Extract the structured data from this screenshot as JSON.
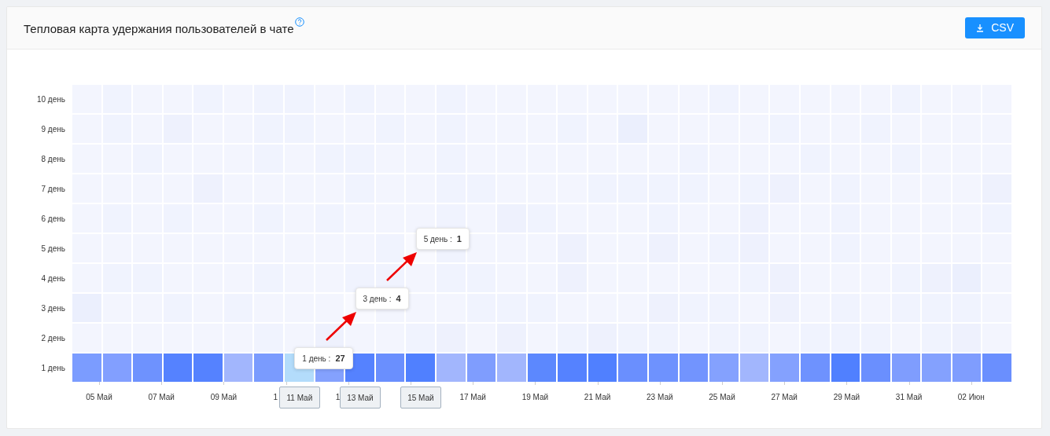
{
  "panel": {
    "title": "Тепловая карта удержания пользователей в чате",
    "export_button": {
      "label": "CSV"
    }
  },
  "heatmap": {
    "rows": [
      {
        "label": "10 день",
        "cells": [
          {
            "color": "#f3f5fe"
          },
          {
            "color": "#f0f3fe"
          },
          {
            "color": "#f3f5fe"
          },
          {
            "color": "#f3f5fe"
          },
          {
            "color": "#f0f3fe"
          },
          {
            "color": "#f3f5fe"
          },
          {
            "color": "#f0f3fe"
          },
          {
            "color": "#f0f3fe"
          },
          {
            "color": "#f3f5fe"
          },
          {
            "color": "#f0f3fe"
          },
          {
            "color": "#f3f5fe"
          },
          {
            "color": "#f3f5fe"
          },
          {
            "color": "#f0f3fe"
          },
          {
            "color": "#f3f5fe"
          },
          {
            "color": "#f3f5fe"
          },
          {
            "color": "#f3f5fe"
          },
          {
            "color": "#f3f5fe"
          },
          {
            "color": "#f3f5fe"
          },
          {
            "color": "#f3f5fe"
          },
          {
            "color": "#f3f5fe"
          },
          {
            "color": "#f3f5fe"
          },
          {
            "color": "#f0f3fe"
          },
          {
            "color": "#f3f5fe"
          },
          {
            "color": "#f3f5fe"
          },
          {
            "color": "#f3f5fe"
          },
          {
            "color": "#f3f5fe"
          },
          {
            "color": "#f3f5fe"
          },
          {
            "color": "#f0f3fe"
          },
          {
            "color": "#f3f5fe"
          },
          {
            "color": "#f3f5fe"
          },
          {
            "color": "#f3f5fe"
          }
        ]
      },
      {
        "label": "9 день",
        "cells": [
          {
            "color": "#f3f5fe"
          },
          {
            "color": "#f0f3fe"
          },
          {
            "color": "#f3f5fe"
          },
          {
            "color": "#eef1fd"
          },
          {
            "color": "#f3f5fe"
          },
          {
            "color": "#f3f5fe"
          },
          {
            "color": "#f0f3fe"
          },
          {
            "color": "#f0f3fe"
          },
          {
            "color": "#f3f5fe"
          },
          {
            "color": "#f3f5fe"
          },
          {
            "color": "#f0f3fe"
          },
          {
            "color": "#f3f5fe"
          },
          {
            "color": "#f0f3fe"
          },
          {
            "color": "#f3f5fe"
          },
          {
            "color": "#f3f5fe"
          },
          {
            "color": "#f3f5fe"
          },
          {
            "color": "#f0f3fe"
          },
          {
            "color": "#f3f5fe"
          },
          {
            "color": "#ebeffd"
          },
          {
            "color": "#f3f5fe"
          },
          {
            "color": "#f3f5fe"
          },
          {
            "color": "#f3f5fe"
          },
          {
            "color": "#f3f5fe"
          },
          {
            "color": "#f0f3fe"
          },
          {
            "color": "#f3f5fe"
          },
          {
            "color": "#f3f5fe"
          },
          {
            "color": "#f0f3fe"
          },
          {
            "color": "#f3f5fe"
          },
          {
            "color": "#f3f5fe"
          },
          {
            "color": "#f3f5fe"
          },
          {
            "color": "#f3f5fe"
          }
        ]
      },
      {
        "label": "8 день",
        "cells": [
          {
            "color": "#f3f5fe"
          },
          {
            "color": "#f3f5fe"
          },
          {
            "color": "#f0f3fe"
          },
          {
            "color": "#f3f5fe"
          },
          {
            "color": "#f3f5fe"
          },
          {
            "color": "#f3f5fe"
          },
          {
            "color": "#f0f3fe"
          },
          {
            "color": "#f3f5fe"
          },
          {
            "color": "#f0f3fe"
          },
          {
            "color": "#f0f3fe"
          },
          {
            "color": "#f3f5fe"
          },
          {
            "color": "#f3f5fe"
          },
          {
            "color": "#f0f3fe"
          },
          {
            "color": "#f3f5fe"
          },
          {
            "color": "#f3f5fe"
          },
          {
            "color": "#f3f5fe"
          },
          {
            "color": "#f3f5fe"
          },
          {
            "color": "#f3f5fe"
          },
          {
            "color": "#f3f5fe"
          },
          {
            "color": "#f3f5fe"
          },
          {
            "color": "#f0f3fe"
          },
          {
            "color": "#f3f5fe"
          },
          {
            "color": "#f3f5fe"
          },
          {
            "color": "#f3f5fe"
          },
          {
            "color": "#f0f3fe"
          },
          {
            "color": "#f3f5fe"
          },
          {
            "color": "#f3f5fe"
          },
          {
            "color": "#f0f3fe"
          },
          {
            "color": "#f3f5fe"
          },
          {
            "color": "#f3f5fe"
          },
          {
            "color": "#f3f5fe"
          }
        ]
      },
      {
        "label": "7 день",
        "cells": [
          {
            "color": "#f3f5fe"
          },
          {
            "color": "#f3f5fe"
          },
          {
            "color": "#f3f5fe"
          },
          {
            "color": "#f3f5fe"
          },
          {
            "color": "#eef1fd"
          },
          {
            "color": "#f3f5fe"
          },
          {
            "color": "#f3f5fe"
          },
          {
            "color": "#f3f5fe"
          },
          {
            "color": "#f3f5fe"
          },
          {
            "color": "#f0f3fe"
          },
          {
            "color": "#f3f5fe"
          },
          {
            "color": "#f3f5fe"
          },
          {
            "color": "#f0f3fe"
          },
          {
            "color": "#f0f3fe"
          },
          {
            "color": "#f3f5fe"
          },
          {
            "color": "#f3f5fe"
          },
          {
            "color": "#f3f5fe"
          },
          {
            "color": "#f0f3fe"
          },
          {
            "color": "#f0f3fe"
          },
          {
            "color": "#f0f3fe"
          },
          {
            "color": "#f0f3fe"
          },
          {
            "color": "#f3f5fe"
          },
          {
            "color": "#f0f3fe"
          },
          {
            "color": "#eef1fd"
          },
          {
            "color": "#f3f5fe"
          },
          {
            "color": "#f0f3fe"
          },
          {
            "color": "#f3f5fe"
          },
          {
            "color": "#f3f5fe"
          },
          {
            "color": "#f3f5fe"
          },
          {
            "color": "#f3f5fe"
          },
          {
            "color": "#eef1fd"
          }
        ]
      },
      {
        "label": "6 день",
        "cells": [
          {
            "color": "#f3f5fe"
          },
          {
            "color": "#f0f3fe"
          },
          {
            "color": "#f3f5fe"
          },
          {
            "color": "#f0f3fe"
          },
          {
            "color": "#f3f5fe"
          },
          {
            "color": "#f3f5fe"
          },
          {
            "color": "#f0f3fe"
          },
          {
            "color": "#f3f5fe"
          },
          {
            "color": "#f0f3fe"
          },
          {
            "color": "#f3f5fe"
          },
          {
            "color": "#f3f5fe"
          },
          {
            "color": "#f3f5fe"
          },
          {
            "color": "#f0f3fe"
          },
          {
            "color": "#f3f5fe"
          },
          {
            "color": "#eef1fd"
          },
          {
            "color": "#f0f3fe"
          },
          {
            "color": "#f3f5fe"
          },
          {
            "color": "#f3f5fe"
          },
          {
            "color": "#f3f5fe"
          },
          {
            "color": "#f0f3fe"
          },
          {
            "color": "#f3f5fe"
          },
          {
            "color": "#f3f5fe"
          },
          {
            "color": "#eef1fd"
          },
          {
            "color": "#f3f5fe"
          },
          {
            "color": "#f3f5fe"
          },
          {
            "color": "#f0f3fe"
          },
          {
            "color": "#f3f5fe"
          },
          {
            "color": "#f3f5fe"
          },
          {
            "color": "#f3f5fe"
          },
          {
            "color": "#f3f5fe"
          },
          {
            "color": "#f0f3fe"
          }
        ]
      },
      {
        "label": "5 день",
        "cells": [
          {
            "color": "#f3f5fe"
          },
          {
            "color": "#f3f5fe"
          },
          {
            "color": "#f3f5fe"
          },
          {
            "color": "#f3f5fe"
          },
          {
            "color": "#f3f5fe"
          },
          {
            "color": "#f3f5fe"
          },
          {
            "color": "#f3f5fe"
          },
          {
            "color": "#f3f5fe"
          },
          {
            "color": "#f3f5fe"
          },
          {
            "color": "#f3f5fe"
          },
          {
            "color": "#f0f3fe"
          },
          {
            "color": "#f8f9ff",
            "tooltip": {
              "label": "5 день :",
              "value": "1",
              "arrow_in": true
            },
            "pointer": "15 Май"
          },
          {
            "color": "#f0f3fe"
          },
          {
            "color": "#f3f5fe"
          },
          {
            "color": "#f3f5fe"
          },
          {
            "color": "#f3f5fe"
          },
          {
            "color": "#eef1fd"
          },
          {
            "color": "#f3f5fe"
          },
          {
            "color": "#f3f5fe"
          },
          {
            "color": "#eef1fd"
          },
          {
            "color": "#f3f5fe"
          },
          {
            "color": "#f0f3fe"
          },
          {
            "color": "#eef1fd"
          },
          {
            "color": "#f3f5fe"
          },
          {
            "color": "#f3f5fe"
          },
          {
            "color": "#f0f3fe"
          },
          {
            "color": "#f3f5fe"
          },
          {
            "color": "#f3f5fe"
          },
          {
            "color": "#f3f5fe"
          },
          {
            "color": "#f3f5fe"
          },
          {
            "color": "#f3f5fe"
          }
        ]
      },
      {
        "label": "4 день",
        "cells": [
          {
            "color": "#f3f5fe"
          },
          {
            "color": "#f0f3fe"
          },
          {
            "color": "#f0f3fe"
          },
          {
            "color": "#f3f5fe"
          },
          {
            "color": "#f3f5fe"
          },
          {
            "color": "#f3f5fe"
          },
          {
            "color": "#f0f3fe"
          },
          {
            "color": "#f3f5fe"
          },
          {
            "color": "#f3f5fe"
          },
          {
            "color": "#f0f3fe"
          },
          {
            "color": "#f0f3fe"
          },
          {
            "color": "#f3f5fe"
          },
          {
            "color": "#f0f3fe"
          },
          {
            "color": "#f0f3fe"
          },
          {
            "color": "#f3f5fe"
          },
          {
            "color": "#f3f5fe"
          },
          {
            "color": "#eef1fd"
          },
          {
            "color": "#f3f5fe"
          },
          {
            "color": "#f3f5fe"
          },
          {
            "color": "#f3f5fe"
          },
          {
            "color": "#f3f5fe"
          },
          {
            "color": "#f3f5fe"
          },
          {
            "color": "#f0f3fe"
          },
          {
            "color": "#eef1fd"
          },
          {
            "color": "#f3f5fe"
          },
          {
            "color": "#f3f5fe"
          },
          {
            "color": "#f3f5fe"
          },
          {
            "color": "#f0f3fe"
          },
          {
            "color": "#eef1fd"
          },
          {
            "color": "#ebeffd"
          },
          {
            "color": "#f3f5fe"
          }
        ]
      },
      {
        "label": "3 день",
        "cells": [
          {
            "color": "#ebeffd"
          },
          {
            "color": "#f3f5fe"
          },
          {
            "color": "#f3f5fe"
          },
          {
            "color": "#f0f3fe"
          },
          {
            "color": "#f3f5fe"
          },
          {
            "color": "#f0f3fe"
          },
          {
            "color": "#f3f5fe"
          },
          {
            "color": "#f3f5fe"
          },
          {
            "color": "#f3f5fe"
          },
          {
            "color": "#f8f9ff",
            "tooltip": {
              "label": "3 день :",
              "value": "4",
              "arrow_in": true
            },
            "pointer": "13 Май"
          },
          {
            "color": "#f3f5fe"
          },
          {
            "color": "#f3f5fe"
          },
          {
            "color": "#f3f5fe"
          },
          {
            "color": "#f0f3fe"
          },
          {
            "color": "#f0f3fe"
          },
          {
            "color": "#f0f3fe"
          },
          {
            "color": "#f3f5fe"
          },
          {
            "color": "#f3f5fe"
          },
          {
            "color": "#f3f5fe"
          },
          {
            "color": "#eef1fd"
          },
          {
            "color": "#f0f3fe"
          },
          {
            "color": "#f0f3fe"
          },
          {
            "color": "#f3f5fe"
          },
          {
            "color": "#eef1fd"
          },
          {
            "color": "#f3f5fe"
          },
          {
            "color": "#f0f3fe"
          },
          {
            "color": "#f3f5fe"
          },
          {
            "color": "#f0f3fe"
          },
          {
            "color": "#f0f3fe"
          },
          {
            "color": "#f0f3fe"
          },
          {
            "color": "#f3f5fe"
          }
        ]
      },
      {
        "label": "2 день",
        "cells": [
          {
            "color": "#f3f5fe"
          },
          {
            "color": "#f3f5fe"
          },
          {
            "color": "#f3f5fe"
          },
          {
            "color": "#f3f5fe"
          },
          {
            "color": "#f3f5fe"
          },
          {
            "color": "#f3f5fe"
          },
          {
            "color": "#f0f3fe"
          },
          {
            "color": "#f3f5fe"
          },
          {
            "color": "#eef1fd"
          },
          {
            "color": "#f3f5fe"
          },
          {
            "color": "#f3f5fe"
          },
          {
            "color": "#f0f3fe"
          },
          {
            "color": "#eef1fd"
          },
          {
            "color": "#f3f5fe"
          },
          {
            "color": "#eef1fd"
          },
          {
            "color": "#f3f5fe"
          },
          {
            "color": "#f0f3fe"
          },
          {
            "color": "#eef1fd"
          },
          {
            "color": "#f0f3fe"
          },
          {
            "color": "#f0f3fe"
          },
          {
            "color": "#f3f5fe"
          },
          {
            "color": "#f0f3fe"
          },
          {
            "color": "#f0f3fe"
          },
          {
            "color": "#f3f5fe"
          },
          {
            "color": "#f0f3fe"
          },
          {
            "color": "#f0f3fe"
          },
          {
            "color": "#f0f3fe"
          },
          {
            "color": "#f3f5fe"
          },
          {
            "color": "#f0f3fe"
          },
          {
            "color": "#eef1fd"
          },
          {
            "color": "#f3f5fe"
          }
        ]
      },
      {
        "label": "1 день",
        "cells": [
          {
            "color": "#7b9cff"
          },
          {
            "color": "#829fff"
          },
          {
            "color": "#6e92fe"
          },
          {
            "color": "#5582ff"
          },
          {
            "color": "#5582ff"
          },
          {
            "color": "#a2b6fd"
          },
          {
            "color": "#7a9bfe"
          },
          {
            "color": "#b3dcfb",
            "tooltip": {
              "label": "1 день :",
              "value": "27",
              "arrow_in": false
            },
            "pointer": "11 Май"
          },
          {
            "color": "#84a1fe"
          },
          {
            "color": "#5582ff"
          },
          {
            "color": "#6a8ffe"
          },
          {
            "color": "#5080ff"
          },
          {
            "color": "#a2b6fd"
          },
          {
            "color": "#7f9dfe"
          },
          {
            "color": "#a2b6fd"
          },
          {
            "color": "#5c88fe"
          },
          {
            "color": "#5582ff"
          },
          {
            "color": "#5080ff"
          },
          {
            "color": "#6a8ffe"
          },
          {
            "color": "#6e92fe"
          },
          {
            "color": "#7294fe"
          },
          {
            "color": "#84a1fe"
          },
          {
            "color": "#a2b6fd"
          },
          {
            "color": "#84a1fe"
          },
          {
            "color": "#6e92fe"
          },
          {
            "color": "#5080ff"
          },
          {
            "color": "#6a8ffe"
          },
          {
            "color": "#7f9dfe"
          },
          {
            "color": "#84a1fe"
          },
          {
            "color": "#7f9dfe"
          },
          {
            "color": "#6a8ffe"
          }
        ]
      }
    ],
    "x_axis": [
      {
        "text": "05 Май",
        "kind": "full"
      },
      {
        "text": "07 Май",
        "kind": "full"
      },
      {
        "text": "09 Май",
        "kind": "full"
      },
      {
        "text": "1",
        "kind": "partial"
      },
      {
        "text": "1",
        "kind": "partial"
      },
      {
        "kind": "covered"
      },
      {
        "text": "17 Май",
        "kind": "full"
      },
      {
        "text": "19 Май",
        "kind": "full"
      },
      {
        "text": "21 Май",
        "kind": "full"
      },
      {
        "text": "23 Май",
        "kind": "full"
      },
      {
        "text": "25 Май",
        "kind": "full"
      },
      {
        "text": "27 Май",
        "kind": "full"
      },
      {
        "text": "29 Май",
        "kind": "full"
      },
      {
        "text": "31 Май",
        "kind": "full"
      },
      {
        "text": "02 Июн",
        "kind": "full"
      }
    ]
  }
}
